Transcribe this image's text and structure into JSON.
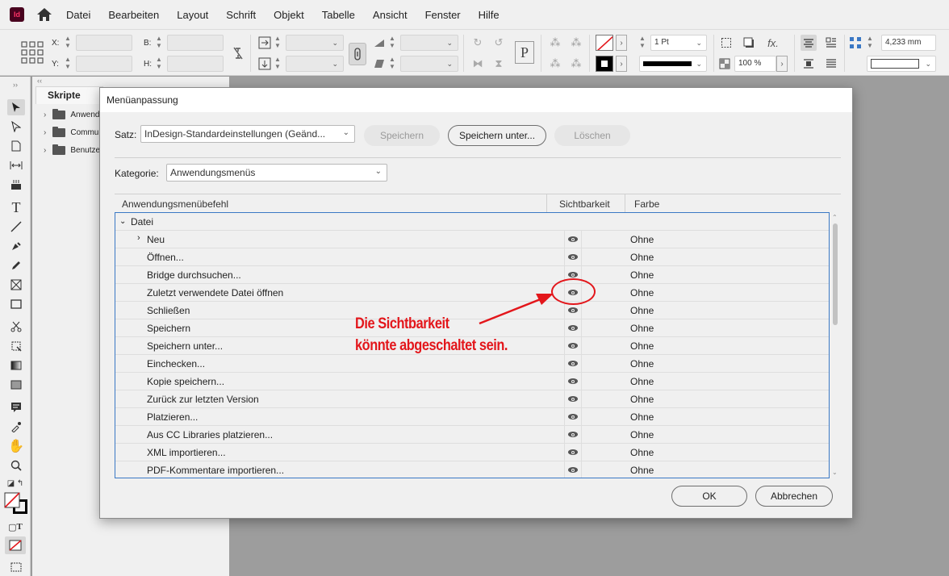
{
  "app": {
    "logo_text": "Id"
  },
  "menubar": {
    "items": [
      "Datei",
      "Bearbeiten",
      "Layout",
      "Schrift",
      "Objekt",
      "Tabelle",
      "Ansicht",
      "Fenster",
      "Hilfe"
    ]
  },
  "controlbar": {
    "x_label": "X:",
    "y_label": "Y:",
    "b_label": "B:",
    "h_label": "H:",
    "stroke_weight": "1 Pt",
    "opacity": "100 %",
    "dimension": "4,233 mm"
  },
  "scripts_panel": {
    "tab_label": "Skripte",
    "folders": [
      "Anwendung",
      "Community",
      "Benutzer"
    ]
  },
  "dialog": {
    "title": "Menüanpassung",
    "set_label": "Satz:",
    "set_value": "InDesign-Standardeinstellungen (Geänd...",
    "save_button": "Speichern",
    "save_as_button": "Speichern unter...",
    "delete_button": "Löschen",
    "category_label": "Kategorie:",
    "category_value": "Anwendungsmenüs",
    "columns": {
      "command": "Anwendungsmenübefehl",
      "visibility": "Sichtbarkeit",
      "color": "Farbe"
    },
    "group": "Datei",
    "rows": [
      {
        "name": "Neu",
        "color": "Ohne",
        "submenu": true
      },
      {
        "name": "Öffnen...",
        "color": "Ohne"
      },
      {
        "name": "Bridge durchsuchen...",
        "color": "Ohne"
      },
      {
        "name": "Zuletzt verwendete Datei öffnen",
        "color": "Ohne"
      },
      {
        "name": "Schließen",
        "color": "Ohne"
      },
      {
        "name": "Speichern",
        "color": "Ohne"
      },
      {
        "name": "Speichern unter...",
        "color": "Ohne"
      },
      {
        "name": "Einchecken...",
        "color": "Ohne"
      },
      {
        "name": "Kopie speichern...",
        "color": "Ohne"
      },
      {
        "name": "Zurück zur letzten Version",
        "color": "Ohne"
      },
      {
        "name": "Platzieren...",
        "color": "Ohne"
      },
      {
        "name": "Aus CC Libraries platzieren...",
        "color": "Ohne"
      },
      {
        "name": "XML importieren...",
        "color": "Ohne"
      },
      {
        "name": "PDF-Kommentare importieren...",
        "color": "Ohne"
      }
    ],
    "ok_button": "OK",
    "cancel_button": "Abbrechen"
  },
  "annotation": {
    "line1": "Die Sichtbarkeit",
    "line2": "könnte abgeschaltet sein.",
    "color": "#e3161b"
  }
}
